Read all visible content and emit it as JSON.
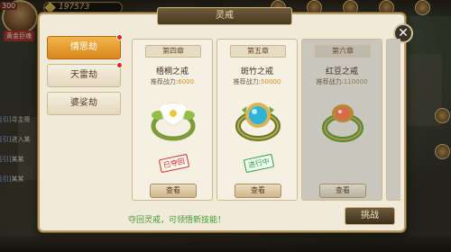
{
  "hud": {
    "level": "300",
    "coins": "197573",
    "left_tag": "黄金巨魂",
    "chat_lines": [
      {
        "tag": "[引]",
        "text": "寻主哥"
      },
      {
        "tag": "[引]",
        "text": "进入某"
      },
      {
        "tag": "[引]",
        "text": "某某"
      },
      {
        "tag": "[引]",
        "text": "某某"
      }
    ]
  },
  "modal": {
    "title": "灵戒",
    "close_symbol": "✕",
    "menu": [
      {
        "label": "情思劫",
        "active": true,
        "badge": true
      },
      {
        "label": "天雷劫",
        "active": false,
        "badge": true
      },
      {
        "label": "婆娑劫",
        "active": false,
        "badge": false
      }
    ],
    "cards": [
      {
        "chapter": "第四章",
        "name": "梧桐之戒",
        "power_label": "推荐战力:",
        "power": "6000",
        "stamp": "已夺回",
        "stamp_type": "red",
        "button": "查看",
        "locked": false
      },
      {
        "chapter": "第五章",
        "name": "斑竹之戒",
        "power_label": "推荐战力:",
        "power": "50000",
        "stamp": "进行中",
        "stamp_type": "green",
        "button": "查看",
        "locked": false
      },
      {
        "chapter": "第六章",
        "name": "红豆之戒",
        "power_label": "推荐战力:",
        "power": "110000",
        "stamp": "",
        "stamp_type": "",
        "button": "查看",
        "locked": true
      }
    ],
    "tip": "夺回灵戒，可领悟新技能！",
    "challenge_button": "挑战"
  },
  "colors": {
    "accent_orange": "#d8871c",
    "tip_green": "#3f9a33",
    "stamp_red": "#d22a20",
    "stamp_green": "#2c9a3c"
  }
}
